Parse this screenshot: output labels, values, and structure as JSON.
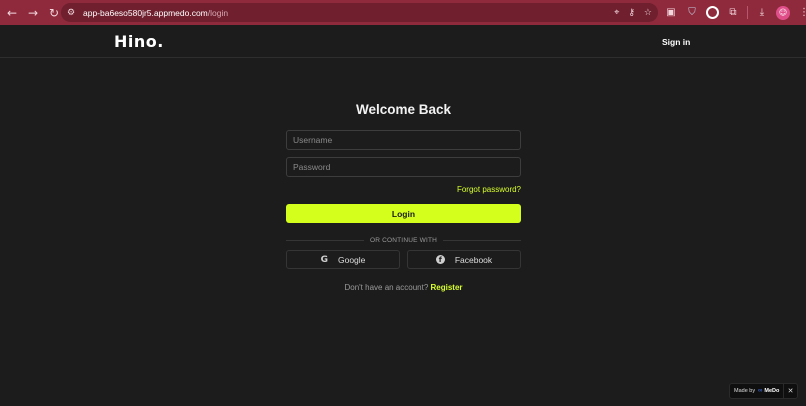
{
  "browser": {
    "url_host": "app-ba6eso580jr5.appmedo.com",
    "url_path": "/login",
    "accent_color": "#8e2a3c"
  },
  "header": {
    "logo": "Hino.",
    "sign_in": "Sign in"
  },
  "login": {
    "title": "Welcome Back",
    "username_placeholder": "Username",
    "password_placeholder": "Password",
    "forgot_password": "Forgot password?",
    "login_button": "Login",
    "divider_text": "OR CONTINUE WITH",
    "google_label": "Google",
    "facebook_label": "Facebook",
    "no_account_text": "Don't have an account?",
    "register_link": "Register",
    "accent_color": "#d4ff1d"
  },
  "badge": {
    "made_by": "Made by",
    "brand": "MeDo"
  }
}
